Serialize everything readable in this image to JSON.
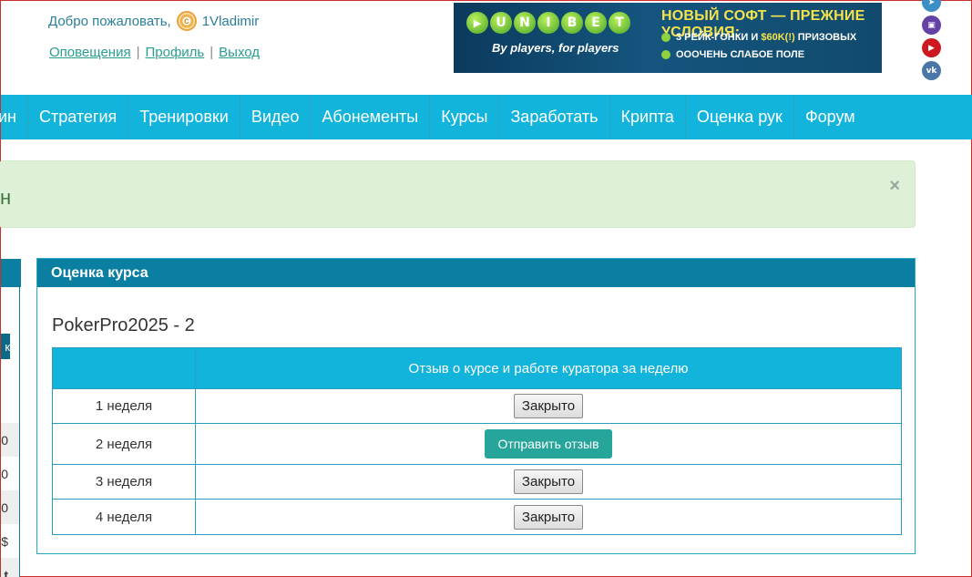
{
  "header": {
    "welcome_text": "Добро пожаловать,",
    "username": "1Vladimir",
    "links": [
      "Оповещения",
      "Профиль",
      "Выход"
    ],
    "separator": "|"
  },
  "banner": {
    "brand_letters": [
      "U",
      "N",
      "I",
      "B",
      "E",
      "T"
    ],
    "tagline": "By players, for players",
    "headline": "НОВЫЙ СОФТ — ПРЕЖНИЕ УСЛОВИЯ:",
    "bullet1_prefix": "3 РЕЙК-ГОНКИ И ",
    "bullet1_highlight": "$60K(!)",
    "bullet1_suffix": " ПРИЗОВЫХ",
    "bullet2": "ОООЧЕНЬ СЛАБОЕ ПОЛЕ"
  },
  "social": {
    "icons": [
      "telegram-icon",
      "twitch-icon",
      "youtube-icon",
      "vk-icon"
    ],
    "colors": [
      "#3b8fc4",
      "#6441a5",
      "#cc181e",
      "#4a76a8"
    ]
  },
  "nav": {
    "items": [
      "ин",
      "Стратегия",
      "Тренировки",
      "Видео",
      "Абонементы",
      "Курсы",
      "Заработать",
      "Крипта",
      "Оценка рук",
      "Форум"
    ],
    "background": "#12b4dc"
  },
  "alert": {
    "text": "н",
    "close": "×"
  },
  "side": {
    "button_char": "к",
    "rows": [
      "0",
      "0",
      "0",
      "$",
      "t"
    ]
  },
  "card": {
    "header": "Оценка курса",
    "course_title": "PokerPro2025 - 2",
    "table": {
      "column_headers": [
        "",
        "Отзыв о курсе и работе куратора за неделю"
      ],
      "rows": [
        {
          "week": "1 неделя",
          "action": "Закрыто",
          "type": "closed"
        },
        {
          "week": "2 неделя",
          "action": "Отправить отзыв",
          "type": "send"
        },
        {
          "week": "3 неделя",
          "action": "Закрыто",
          "type": "closed"
        },
        {
          "week": "4 неделя",
          "action": "Закрыто",
          "type": "closed"
        }
      ]
    }
  },
  "colors": {
    "accent": "#12b4dc",
    "header_dark": "#0a7fa2",
    "success_bg": "#dff0d8",
    "send_button": "#26a69a"
  }
}
